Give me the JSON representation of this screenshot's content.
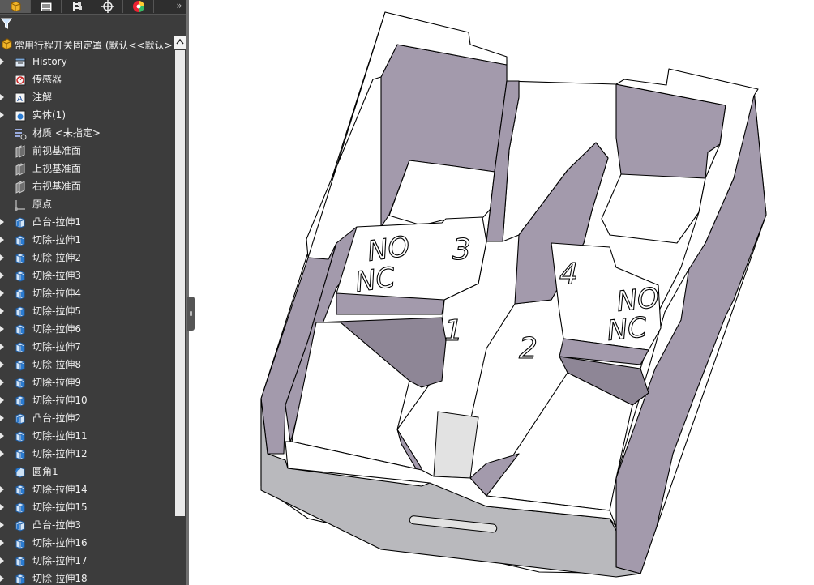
{
  "panel": {
    "tabs": [
      "feature-manager",
      "property-manager",
      "configuration-manager",
      "dimxpert-manager",
      "display-manager"
    ],
    "more_label": "»",
    "root": {
      "label": "常用行程开关固定罩 (默认<<默认>"
    },
    "items": [
      {
        "label": "History",
        "icon": "history-icon",
        "expand": true
      },
      {
        "label": "传感器",
        "icon": "sensor-icon",
        "expand": false
      },
      {
        "label": "注解",
        "icon": "annotation-icon",
        "expand": true
      },
      {
        "label": "实体(1)",
        "icon": "solid-bodies-icon",
        "expand": true
      },
      {
        "label": "材质 <未指定>",
        "icon": "material-icon",
        "expand": false
      },
      {
        "label": "前视基准面",
        "icon": "plane-icon",
        "expand": false
      },
      {
        "label": "上视基准面",
        "icon": "plane-icon",
        "expand": false
      },
      {
        "label": "右视基准面",
        "icon": "plane-icon",
        "expand": false
      },
      {
        "label": "原点",
        "icon": "origin-icon",
        "expand": false
      },
      {
        "label": "凸台-拉伸1",
        "icon": "boss-extrude-icon",
        "expand": true
      },
      {
        "label": "切除-拉伸1",
        "icon": "cut-extrude-icon",
        "expand": true
      },
      {
        "label": "切除-拉伸2",
        "icon": "cut-extrude-icon",
        "expand": true
      },
      {
        "label": "切除-拉伸3",
        "icon": "cut-extrude-icon",
        "expand": true
      },
      {
        "label": "切除-拉伸4",
        "icon": "cut-extrude-icon",
        "expand": true
      },
      {
        "label": "切除-拉伸5",
        "icon": "cut-extrude-icon",
        "expand": true
      },
      {
        "label": "切除-拉伸6",
        "icon": "cut-extrude-icon",
        "expand": true
      },
      {
        "label": "切除-拉伸7",
        "icon": "cut-extrude-icon",
        "expand": true
      },
      {
        "label": "切除-拉伸8",
        "icon": "cut-extrude-icon",
        "expand": true
      },
      {
        "label": "切除-拉伸9",
        "icon": "cut-extrude-icon",
        "expand": true
      },
      {
        "label": "切除-拉伸10",
        "icon": "cut-extrude-icon",
        "expand": true
      },
      {
        "label": "凸台-拉伸2",
        "icon": "boss-extrude-icon",
        "expand": true
      },
      {
        "label": "切除-拉伸11",
        "icon": "cut-extrude-icon",
        "expand": true
      },
      {
        "label": "切除-拉伸12",
        "icon": "cut-extrude-icon",
        "expand": true
      },
      {
        "label": "圆角1",
        "icon": "fillet-icon",
        "expand": false
      },
      {
        "label": "切除-拉伸14",
        "icon": "cut-extrude-icon",
        "expand": true
      },
      {
        "label": "切除-拉伸15",
        "icon": "cut-extrude-icon",
        "expand": true
      },
      {
        "label": "凸台-拉伸3",
        "icon": "boss-extrude-icon",
        "expand": true
      },
      {
        "label": "切除-拉伸16",
        "icon": "cut-extrude-icon",
        "expand": true
      },
      {
        "label": "切除-拉伸17",
        "icon": "cut-extrude-icon",
        "expand": true
      },
      {
        "label": "切除-拉伸18",
        "icon": "cut-extrude-icon",
        "expand": true
      }
    ]
  },
  "model": {
    "engravings": {
      "no_left": "NO",
      "nc_left": "NC",
      "no_right": "NO",
      "nc_right": "NC",
      "n1": "1",
      "n2": "2",
      "n3": "3",
      "n4": "4"
    },
    "colors": {
      "top_face": "#ffffff",
      "side_face": "#a39aac",
      "shadow_face": "#8e8696",
      "front_face": "#b8b8bc",
      "edge": "#000000",
      "panel_bg": "#3c3c3c",
      "tree_text": "#f0f0f0"
    }
  }
}
